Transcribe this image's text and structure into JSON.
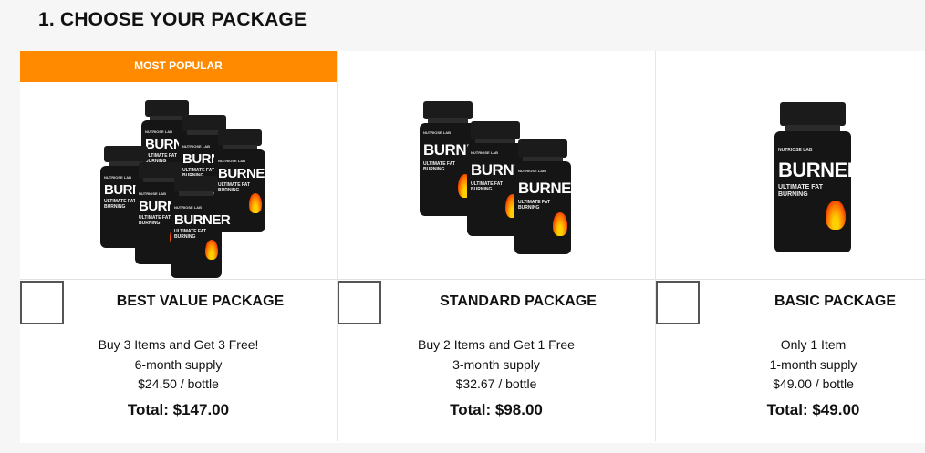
{
  "heading": "1. CHOOSE YOUR PACKAGE",
  "bottle_label": {
    "brand": "NUTRIOSE LAB",
    "name": "BURNER",
    "sub1": "ULTIMATE FAT",
    "sub2": "BURNING"
  },
  "packages": [
    {
      "badge": "MOST POPULAR",
      "title": "BEST VALUE PACKAGE",
      "line1": "Buy 3 Items and Get 3 Free!",
      "line2": "6-month supply",
      "line3": "$24.50 / bottle",
      "total": "Total: $147.00"
    },
    {
      "title": "STANDARD PACKAGE",
      "line1": "Buy 2 Items and Get 1 Free",
      "line2": "3-month supply",
      "line3": "$32.67 / bottle",
      "total": "Total: $98.00"
    },
    {
      "title": "BASIC PACKAGE",
      "line1": "Only 1 Item",
      "line2": "1-month supply",
      "line3": "$49.00 / bottle",
      "total": "Total: $49.00"
    }
  ],
  "colors": {
    "badge": "#ff8a00",
    "background": "#f6f6f6",
    "card": "#ffffff"
  }
}
